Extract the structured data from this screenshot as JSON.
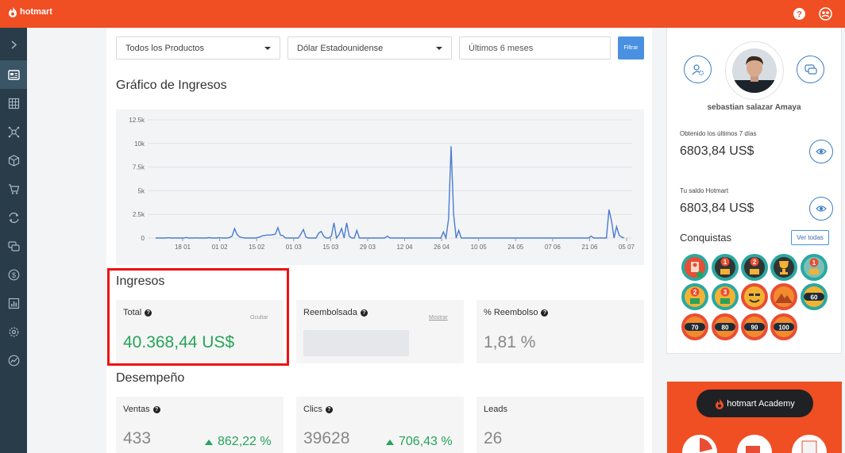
{
  "app": {
    "logo": "hotmart"
  },
  "filters": {
    "product": "Todos los Productos",
    "currency": "Dólar Estadounidense",
    "period_placeholder": "Últimos 6 meses",
    "filter_button": "Filtrar"
  },
  "revenue_chart": {
    "title": "Gráfico de Ingresos"
  },
  "chart_data": {
    "type": "line",
    "title": "Gráfico de Ingresos",
    "y_ticks": [
      "0",
      "2.5k",
      "5k",
      "7.5k",
      "10k",
      "12.5k"
    ],
    "x_ticks": [
      "18 01",
      "01 02",
      "15 02",
      "01 03",
      "15 03",
      "29 03",
      "12 04",
      "26 04",
      "10 05",
      "24 05",
      "07 06",
      "21 06",
      "05 07"
    ],
    "ylim": [
      0,
      12500
    ],
    "grid": true,
    "color": "#4a7cd1",
    "series": [
      {
        "values": [
          0,
          0,
          0,
          0,
          0,
          30,
          0,
          0,
          20,
          0,
          0,
          0,
          60,
          0,
          0,
          0,
          20,
          0,
          0,
          0,
          0,
          40,
          0,
          0,
          0,
          30,
          0,
          0,
          0,
          50,
          200,
          1000,
          350,
          120,
          40,
          0,
          0,
          0,
          0,
          0,
          50,
          120,
          250,
          280,
          320,
          300,
          350,
          400,
          1100,
          300,
          250,
          0,
          0,
          0,
          0,
          0,
          0,
          400,
          900,
          100,
          0,
          0,
          0,
          0,
          500,
          700,
          200,
          0,
          0,
          200,
          1600,
          0,
          350,
          1000,
          0,
          1600,
          200,
          0,
          0,
          800,
          0,
          0,
          0,
          0,
          0,
          0,
          0,
          0,
          0,
          0,
          0,
          200,
          0,
          0,
          0,
          0,
          0,
          0,
          0,
          0,
          0,
          0,
          0,
          0,
          0,
          0,
          0,
          0,
          0,
          0,
          0,
          0,
          0,
          650,
          0,
          2000,
          9700,
          2500,
          0,
          800,
          0,
          0,
          0,
          0,
          0,
          0,
          0,
          0,
          0,
          0,
          0,
          0,
          0,
          0,
          0,
          0,
          0,
          0,
          0,
          0,
          0,
          0,
          0,
          0,
          0,
          0,
          0,
          0,
          0,
          0,
          0,
          0,
          0,
          0,
          0,
          0,
          0,
          0,
          0,
          0,
          0,
          0,
          0,
          0,
          0,
          0,
          0,
          0,
          0,
          0,
          0,
          200,
          0,
          0,
          0,
          0,
          0,
          0,
          3000,
          1800,
          0,
          1200,
          300,
          100,
          0
        ]
      }
    ]
  },
  "ingresos": {
    "title": "Ingresos",
    "total_label": "Total",
    "hide_link": "Ocultar",
    "total_value": "40.368,44 US$",
    "refund_label": "Reembolsada",
    "show_link": "Mostrar",
    "refund_pct_label": "% Reembolso",
    "refund_pct_value": "1,81 %"
  },
  "desempeno": {
    "title": "Desempeño",
    "sales_label": "Ventas",
    "sales_value": "433",
    "sales_trend": "862,22 %",
    "clicks_label": "Clics",
    "clicks_value": "39628",
    "clicks_trend": "706,43 %",
    "leads_label": "Leads",
    "leads_value": "26"
  },
  "profile": {
    "name": "sebastian salazar Amaya",
    "earned_label": "Obtenido los últimos 7 días",
    "earned_value": "6803,84 US$",
    "balance_label": "Tu saldo Hotmart",
    "balance_value": "6803,84 US$",
    "achievements_title": "Conquistas",
    "see_all": "Ver todas",
    "badge_numbers": [
      "1",
      "2",
      "1",
      "2",
      "3",
      "60",
      "70",
      "80",
      "90",
      "100"
    ]
  },
  "academy": {
    "label": "hotmart Academy"
  },
  "colors": {
    "brand": "#f04e23",
    "sidebar": "#283c4a",
    "accent_blue": "#4a90e2",
    "positive": "#27a35a"
  }
}
